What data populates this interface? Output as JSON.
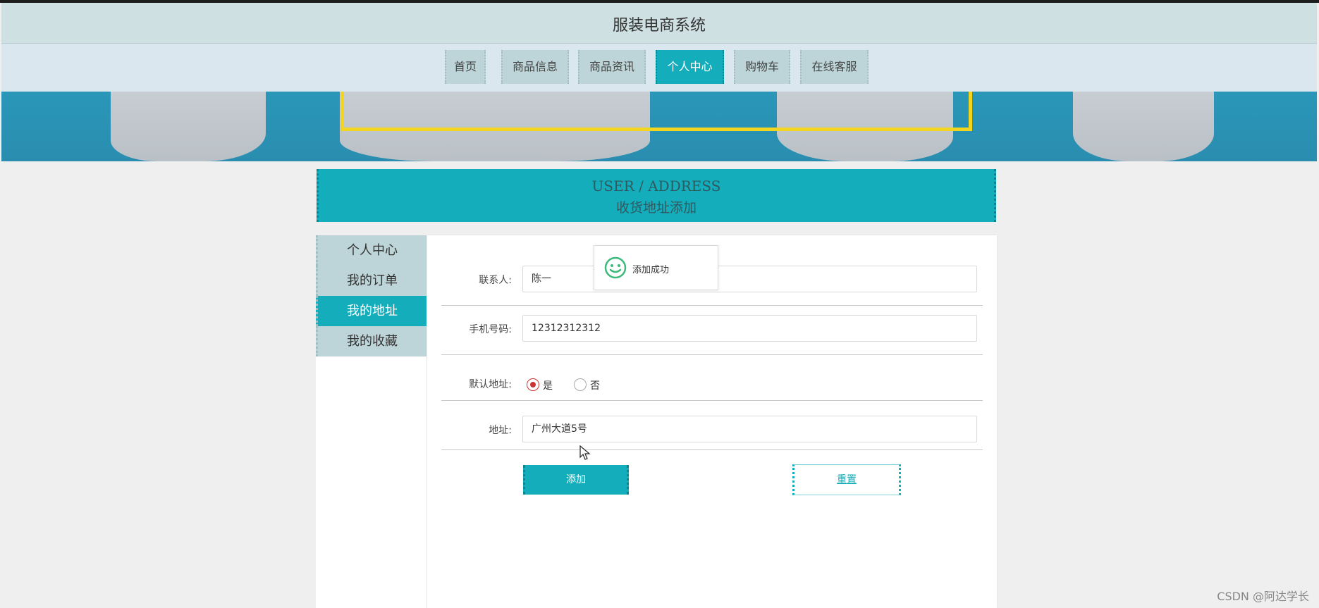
{
  "header": {
    "site_title": "服装电商系统"
  },
  "nav": {
    "items": [
      {
        "label": "首页"
      },
      {
        "label": "商品信息"
      },
      {
        "label": "商品资讯"
      },
      {
        "label": "个人中心",
        "active": true
      },
      {
        "label": "购物车"
      },
      {
        "label": "在线客服"
      }
    ]
  },
  "page_title": {
    "en": "USER / ADDRESS",
    "cn": "收货地址添加"
  },
  "sidebar": {
    "items": [
      {
        "label": "个人中心"
      },
      {
        "label": "我的订单"
      },
      {
        "label": "我的地址",
        "active": true
      },
      {
        "label": "我的收藏"
      }
    ]
  },
  "form": {
    "contact": {
      "label": "联系人:",
      "value": "陈一"
    },
    "phone": {
      "label": "手机号码:",
      "value": "12312312312"
    },
    "default_address": {
      "label": "默认地址:",
      "options": [
        "是",
        "否"
      ],
      "selected": "是"
    },
    "address": {
      "label": "地址:",
      "value": "广州大道5号"
    },
    "add_label": "添加",
    "reset_label": "重置"
  },
  "toast": {
    "message": "添加成功",
    "icon": "smile-icon"
  },
  "watermark": "CSDN @阿达学长",
  "colors": {
    "accent": "#13adbb",
    "header_bg": "#cfe0e3",
    "nav_bg": "#dae7ee",
    "tab_bg": "#bdd5d8",
    "radio_checked": "#cc3333"
  }
}
